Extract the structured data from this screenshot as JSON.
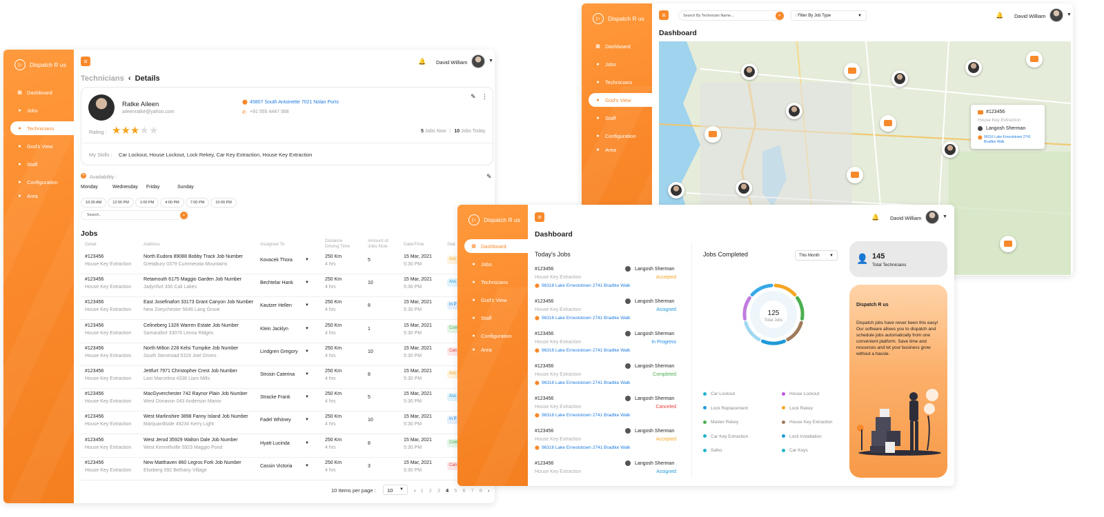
{
  "brand": "Dispatch R us",
  "colors": {
    "accent": "#f8892b",
    "accepted": "#f5a623",
    "assigned": "#1e9ad6",
    "in_progress": "#1e88e5",
    "completed": "#4caf50",
    "canceled": "#e53935"
  },
  "nav": [
    "Dashboard",
    "Jobs",
    "Technicians",
    "God's View",
    "Staff",
    "Configuration",
    "Area"
  ],
  "user": {
    "name": "David William"
  },
  "tech": {
    "breadcrumb_parent": "Technicians",
    "breadcrumb_current": "Details",
    "name": "Ratke Aileen",
    "email": "aileenratke@yahoo.com",
    "address": "45807 South Antoinette 7021 Nolan Ports",
    "phone": "+91 555 4447 568",
    "rating_label": "Rating :",
    "rating": 3,
    "jobs_now": "5",
    "jobs_now_label": "Jobs Now",
    "jobs_today": "10",
    "jobs_today_label": "Jobs Today",
    "skills_label": "My Skills :",
    "skills": "Car Lockout, House Lockout, Lock Rekey, Car Key Extraction, House Key Extraction",
    "availability_label": "Availability :",
    "days": [
      "Monday",
      "Wednesday",
      "Friday",
      "Sunday"
    ],
    "times": [
      "10:30 AM",
      "12:00 PM",
      "1:00 PM",
      "4:00 PM",
      "7:00 PM",
      "10:00 PM"
    ],
    "search_placeholder": "Search..",
    "jobs_title": "Jobs",
    "columns": [
      "Detail",
      "Address",
      "Assigned To",
      "Distance Driving Time",
      "Amount of Jobs Now",
      "Date/Time",
      "Stat"
    ],
    "rows": [
      {
        "id": "#123456",
        "type": "House Key Extraction",
        "addr1": "North Eudora 89088 Bobby Track Job Number",
        "addr2": "Gretabury 0379 Cummerata Mountains",
        "assigned": "Kovacek Thora",
        "dist": "250 Km",
        "time": "4 hrs",
        "amount": "5",
        "date": "15 Mar, 2021",
        "clock": "5:30 PM",
        "status": "Acc",
        "sc": "#f5a623",
        "sb": "#fff3dd"
      },
      {
        "id": "#123456",
        "type": "House Key Extraction",
        "addr1": "Retamouth 6175 Maggio Garden Job Number",
        "addr2": "Jadynfurt 330 Cali Lakes",
        "assigned": "Bechtelar Hank",
        "dist": "250 Km",
        "time": "4 hrs",
        "amount": "10",
        "date": "15 Mar, 2021",
        "clock": "5:30 PM",
        "status": "Ass",
        "sc": "#1e9ad6",
        "sb": "#e1f3fb"
      },
      {
        "id": "#123456",
        "type": "House Key Extraction",
        "addr1": "East Josefinafort 33173 Grant Canyon Job Number",
        "addr2": "New Zoeychester 5646 Lang Grove",
        "assigned": "Kautzer Hellen",
        "dist": "250 Km",
        "time": "4 hrs",
        "amount": "8",
        "date": "15 Mar, 2021",
        "clock": "5:30 PM",
        "status": "In P",
        "sc": "#1e88e5",
        "sb": "#e3effc"
      },
      {
        "id": "#123456",
        "type": "House Key Extraction",
        "addr1": "Celineberg 1326 Warren Estate Job Number",
        "addr2": "Samarafort 33076 Lenna Ridges",
        "assigned": "Klein Jacklyn",
        "dist": "250 Km",
        "time": "4 hrs",
        "amount": "1",
        "date": "15 Mar, 2021",
        "clock": "5:30 PM",
        "status": "Com",
        "sc": "#4caf50",
        "sb": "#e5f5e6"
      },
      {
        "id": "#123456",
        "type": "House Key Extraction",
        "addr1": "North Milton 228 Kelsi Turnpike Job Number",
        "addr2": "South Stevestad 5319 Joel Drives",
        "assigned": "Lindgren Gregory",
        "dist": "250 Km",
        "time": "4 hrs",
        "amount": "10",
        "date": "15 Mar, 2021",
        "clock": "5:30 PM",
        "status": "Can",
        "sc": "#e53935",
        "sb": "#fde7e7"
      },
      {
        "id": "#123456",
        "type": "House Key Extraction",
        "addr1": "Jettfurt 7971 Christopher Crest Job Number",
        "addr2": "Last Marcelina 4338 Liam Mills",
        "assigned": "Strosin Caterina",
        "dist": "250 Km",
        "time": "4 hrs",
        "amount": "8",
        "date": "15 Mar, 2021",
        "clock": "5:30 PM",
        "status": "Acc",
        "sc": "#f5a623",
        "sb": "#fff3dd"
      },
      {
        "id": "#123456",
        "type": "House Key Extraction",
        "addr1": "MacGyverchester 742 Raynor Plain Job Number",
        "addr2": "West Donavon 043 Anderson Manor",
        "assigned": "Stracke Frank",
        "dist": "250 Km",
        "time": "4 hrs",
        "amount": "5",
        "date": "15 Mar, 2021",
        "clock": "5:30 PM",
        "status": "Ass",
        "sc": "#1e9ad6",
        "sb": "#e1f3fb"
      },
      {
        "id": "#123456",
        "type": "House Key Extraction",
        "addr1": "West Marlinshire 3898 Fanny Island Job Number",
        "addr2": "Marquardtside 49234 Kerry Light",
        "assigned": "Fadel Whitney",
        "dist": "250 Km",
        "time": "4 hrs",
        "amount": "10",
        "date": "15 Mar, 2021",
        "clock": "5:30 PM",
        "status": "In P",
        "sc": "#1e88e5",
        "sb": "#e3effc"
      },
      {
        "id": "#123456",
        "type": "House Key Extraction",
        "addr1": "West Jerod 35929 Walton Dale Job Number",
        "addr2": "West Kennithville 0923 Maggio Pond",
        "assigned": "Hyatt Lucinda",
        "dist": "250 Km",
        "time": "4 hrs",
        "amount": "8",
        "date": "15 Mar, 2021",
        "clock": "5:30 PM",
        "status": "Com",
        "sc": "#4caf50",
        "sb": "#e5f5e6"
      },
      {
        "id": "#123456",
        "type": "House Key Extraction",
        "addr1": "New Matthaven 860 Legros Fork Job Number",
        "addr2": "Elseberg 092 Bethany Village",
        "assigned": "Cassin Victoria",
        "dist": "250 Km",
        "time": "4 hrs",
        "amount": "3",
        "date": "15 Mar, 2021",
        "clock": "5:30 PM",
        "status": "Can",
        "sc": "#e53935",
        "sb": "#fde7e7"
      }
    ],
    "items_per_page_label": "10 Items per page :",
    "items_per_page": "10",
    "pages": [
      "1",
      "2",
      "3",
      "4",
      "5",
      "6",
      "7",
      "8"
    ],
    "current_page": "4"
  },
  "dashboard": {
    "title": "Dashboard",
    "todays_jobs_title": "Today's Jobs",
    "jobs": [
      {
        "id": "#123456",
        "tech": "Langosh Sherman",
        "type": "House Key Extraction",
        "status": "Accepted",
        "addr": "96316 Lake Ernestotown 2741 Bradtke Walk",
        "sc": "#f5a623"
      },
      {
        "id": "#123456",
        "tech": "Langosh Sherman",
        "type": "House Key Extraction",
        "status": "Assigned",
        "addr": "96316 Lake Ernestotown 2741 Bradtke Walk",
        "sc": "#1e9ad6"
      },
      {
        "id": "#123456",
        "tech": "Langosh Sherman",
        "type": "House Key Extraction",
        "status": "In Progress",
        "addr": "96316 Lake Ernestotown 2741 Bradtke Walk",
        "sc": "#1e88e5"
      },
      {
        "id": "#123456",
        "tech": "Langosh Sherman",
        "type": "House Key Extraction",
        "status": "Completed",
        "addr": "96316 Lake Ernestotown 2741 Bradtke Walk",
        "sc": "#4caf50"
      },
      {
        "id": "#123456",
        "tech": "Langosh Sherman",
        "type": "House Key Extraction",
        "status": "Canceled",
        "addr": "96316 Lake Ernestotown 2741 Bradtke Walk",
        "sc": "#e53935"
      },
      {
        "id": "#123456",
        "tech": "Langosh Sherman",
        "type": "House Key Extraction",
        "status": "Accepted",
        "addr": "96316 Lake Ernestotown 2741 Bradtke Walk",
        "sc": "#f5a623"
      },
      {
        "id": "#123456",
        "tech": "Langosh Sherman",
        "type": "House Key Extraction",
        "status": "Assigned",
        "addr": "",
        "sc": "#1e9ad6"
      }
    ],
    "jobs_completed_title": "Jobs Completed",
    "period": "This Month",
    "total_jobs": "125",
    "total_jobs_label": "Total Jobs",
    "donut_colors": [
      "#f5a623",
      "#4caf50",
      "#9e7b5c",
      "#1e9ad6",
      "#a0d8f0",
      "#c07be0",
      "#36a8e8"
    ],
    "legend": [
      {
        "label": "Car Lockout",
        "color": "#1eb5c9"
      },
      {
        "label": "House Lockout",
        "color": "#c058e0"
      },
      {
        "label": "Lock Replacement",
        "color": "#1e9ad6"
      },
      {
        "label": "Lock Rekey",
        "color": "#f5a623"
      },
      {
        "label": "Master Rekey",
        "color": "#4caf50"
      },
      {
        "label": "House Key Extraction",
        "color": "#9e7b5c"
      },
      {
        "label": "Car Key Extraction",
        "color": "#1eb5c9"
      },
      {
        "label": "Lock Installation",
        "color": "#1e9ad6"
      },
      {
        "label": "Safes",
        "color": "#1eb5c9"
      },
      {
        "label": "Car Keys",
        "color": "#1eb5c9"
      }
    ],
    "total_technicians": "145",
    "total_technicians_label": "Total Technicians",
    "promo_title": "Dispatch R us",
    "promo_text": "Dispatch jobs have never been this easy! Our software allows you to dispatch and schedule jobs automatically from one convenient platform. Save time and resources and let your business grow without a hassle."
  },
  "gods_view": {
    "title": "Dashboard",
    "search_placeholder": "Search By Technician Name...",
    "filter_label": "Filter By Job Type",
    "popup": {
      "id": "#123456",
      "type": "House Key Extraction",
      "tech": "Langosh Sherman",
      "addr": "96316 Lake Ernestotown 2741 Bradtke Walk"
    }
  }
}
